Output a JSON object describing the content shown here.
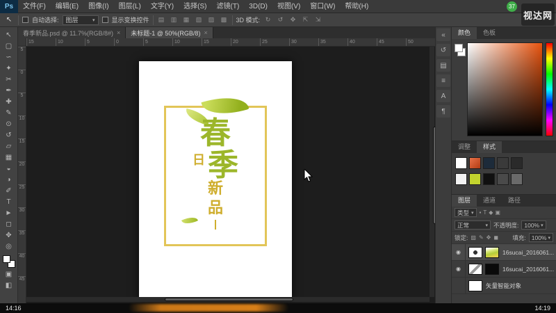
{
  "menubar": {
    "logo": "Ps",
    "items": [
      "文件(F)",
      "编辑(E)",
      "图像(I)",
      "图层(L)",
      "文字(Y)",
      "选择(S)",
      "滤镜(T)",
      "3D(D)",
      "视图(V)",
      "窗口(W)",
      "帮助(H)"
    ],
    "badge": "37",
    "site_logo": "视达网"
  },
  "optionsbar": {
    "auto_select_label": "自动选择:",
    "auto_select_value": "图层",
    "show_transform_label": "显示变换控件",
    "mode_label": "3D 模式:"
  },
  "tabs": [
    {
      "label": "春季新品.psd @ 11.7%(RGB/8#)",
      "close": "×"
    },
    {
      "label": "未标题-1 @ 50%(RGB/8)",
      "close": "×"
    }
  ],
  "rulers": {
    "top": [
      "15",
      "10",
      "5",
      "0",
      "5",
      "10",
      "15",
      "20",
      "25",
      "30",
      "35",
      "40",
      "45",
      "50"
    ],
    "left": [
      "5",
      "0",
      "5",
      "10",
      "15",
      "20",
      "25",
      "30",
      "35",
      "40",
      "45"
    ]
  },
  "tools": [
    {
      "name": "move-tool",
      "glyph": "↖"
    },
    {
      "name": "marquee-tool",
      "glyph": "▢"
    },
    {
      "name": "lasso-tool",
      "glyph": "∽"
    },
    {
      "name": "quick-selection-tool",
      "glyph": "✦"
    },
    {
      "name": "crop-tool",
      "glyph": "✂"
    },
    {
      "name": "eyedropper-tool",
      "glyph": "✒"
    },
    {
      "name": "healing-brush-tool",
      "glyph": "✚"
    },
    {
      "name": "brush-tool",
      "glyph": "✎"
    },
    {
      "name": "clone-stamp-tool",
      "glyph": "⊙"
    },
    {
      "name": "history-brush-tool",
      "glyph": "↺"
    },
    {
      "name": "eraser-tool",
      "glyph": "▱"
    },
    {
      "name": "gradient-tool",
      "glyph": "▦"
    },
    {
      "name": "blur-tool",
      "glyph": "◒"
    },
    {
      "name": "dodge-tool",
      "glyph": "◑"
    },
    {
      "name": "pen-tool",
      "glyph": "✐"
    },
    {
      "name": "type-tool",
      "glyph": "T"
    },
    {
      "name": "path-selection-tool",
      "glyph": "►"
    },
    {
      "name": "shape-tool",
      "glyph": "◻"
    },
    {
      "name": "hand-tool",
      "glyph": "✥"
    },
    {
      "name": "zoom-tool",
      "glyph": "◎"
    }
  ],
  "icons": {
    "caret": "▾",
    "eye": "◉",
    "align": [
      "▤",
      "▥",
      "▦",
      "▧",
      "▨",
      "▩"
    ],
    "mode3d": [
      "↻",
      "↺",
      "✥",
      "⇱",
      "⇲"
    ],
    "collapsed": [
      "«",
      "↺",
      "▤",
      "≡",
      "A",
      "¶"
    ],
    "filter": [
      "▪",
      "T",
      "◆",
      "▣"
    ],
    "lock": [
      "▨",
      "✎",
      "✥",
      "◼"
    ],
    "quick_mask": "▣",
    "screen_mode": "◧"
  },
  "artwork": {
    "char_1": "春",
    "char_2": "日",
    "char_3": "季",
    "char_4": "新",
    "char_5": "品"
  },
  "panels": {
    "color": {
      "tabs": [
        "颜色",
        "色板"
      ]
    },
    "styles": {
      "tabs": [
        "调整",
        "样式"
      ],
      "swatches_row1": [
        {
          "css": "background:#ffffff"
        },
        {
          "css": "background:linear-gradient(135deg,#e8734a,#b33b12)"
        },
        {
          "css": "background:#1d2b3a"
        },
        {
          "css": "background:#3a3a3a"
        },
        {
          "css": "background:#2a2a2a"
        }
      ],
      "swatches_row2": [
        {
          "css": "background:#f2f2f2"
        },
        {
          "css": "background:#c3d42e"
        },
        {
          "css": "background:#101010"
        },
        {
          "css": "background:#4a4a4a"
        },
        {
          "css": "background:#6a6a6a"
        }
      ]
    },
    "layers": {
      "tabs": [
        "图层",
        "通道",
        "路径"
      ],
      "filter_label": "类型",
      "blend_mode": "正常",
      "opacity_label": "不透明度:",
      "opacity_value": "100%",
      "lock_label": "锁定:",
      "fill_label": "填充:",
      "fill_value": "100%",
      "layers": [
        {
          "name": "16sucai_2016061..."
        },
        {
          "name": "16sucai_2016061..."
        },
        {
          "name": "矢量智能对象"
        }
      ]
    }
  },
  "statusbar": {
    "time_current": "14:16",
    "time_total": "14:19"
  }
}
